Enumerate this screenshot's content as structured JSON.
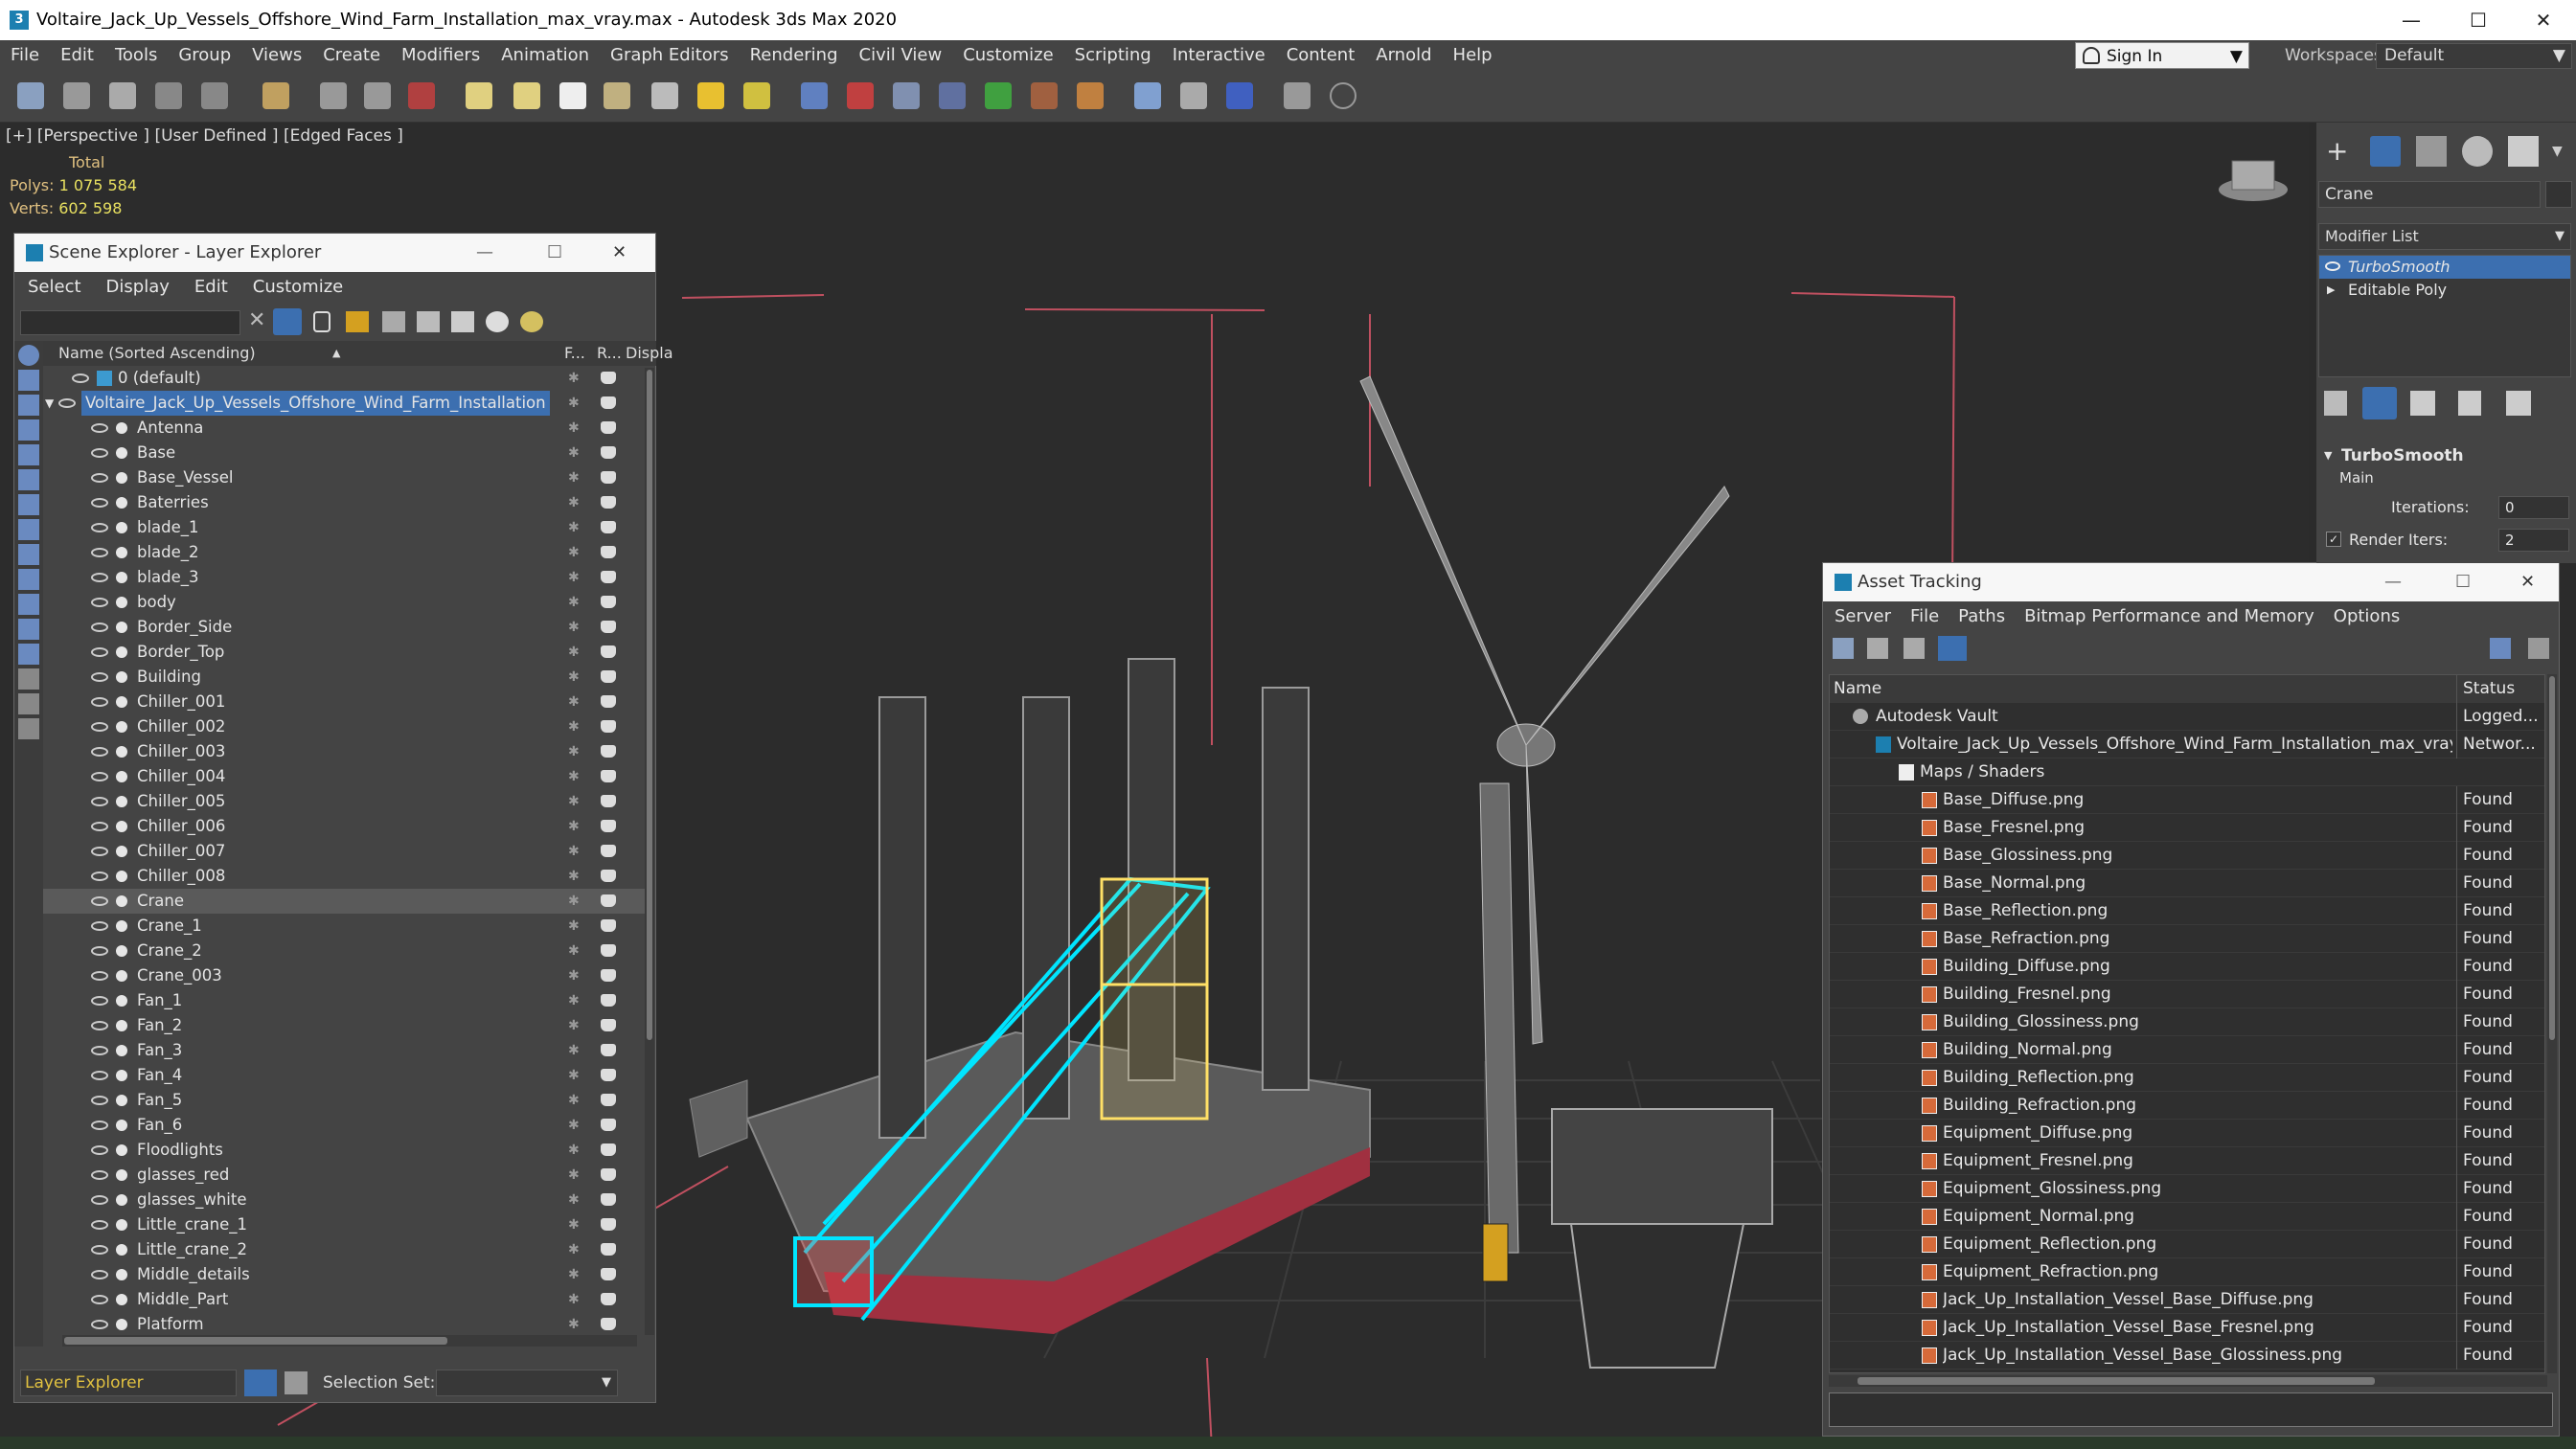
{
  "window": {
    "title": "Voltaire_Jack_Up_Vessels_Offshore_Wind_Farm_Installation_max_vray.max - Autodesk 3ds Max 2020"
  },
  "menu": [
    "File",
    "Edit",
    "Tools",
    "Group",
    "Views",
    "Create",
    "Modifiers",
    "Animation",
    "Graph Editors",
    "Rendering",
    "Civil View",
    "Customize",
    "Scripting",
    "Interactive",
    "Content",
    "Arnold",
    "Help"
  ],
  "signin": {
    "label": "Sign In"
  },
  "workspace": {
    "label": "Workspaces:",
    "value": "Default"
  },
  "viewport": {
    "label": "[+] [Perspective ] [User Defined ] [Edged Faces ]",
    "stats_title": "Total",
    "polys_label": "Polys:",
    "polys": "1 075 584",
    "verts_label": "Verts:",
    "verts": "602 598"
  },
  "scene_explorer": {
    "title": "Scene Explorer - Layer Explorer",
    "menu": [
      "Select",
      "Display",
      "Edit",
      "Customize"
    ],
    "columns": {
      "name": "Name (Sorted Ascending)",
      "frozen": "F...",
      "render": "R...",
      "display": "Displa"
    },
    "default_layer": "0 (default)",
    "root_layer": "Voltaire_Jack_Up_Vessels_Offshore_Wind_Farm_Installation",
    "items": [
      "Antenna",
      "Base",
      "Base_Vessel",
      "Baterries",
      "blade_1",
      "blade_2",
      "blade_3",
      "body",
      "Border_Side",
      "Border_Top",
      "Building",
      "Chiller_001",
      "Chiller_002",
      "Chiller_003",
      "Chiller_004",
      "Chiller_005",
      "Chiller_006",
      "Chiller_007",
      "Chiller_008",
      "Crane",
      "Crane_1",
      "Crane_2",
      "Crane_003",
      "Fan_1",
      "Fan_2",
      "Fan_3",
      "Fan_4",
      "Fan_5",
      "Fan_6",
      "Floodlights",
      "glasses_red",
      "glasses_white",
      "Little_crane_1",
      "Little_crane_2",
      "Middle_details",
      "Middle_Part",
      "Platform"
    ],
    "selected_item": "Crane",
    "explorer_select": "Layer Explorer",
    "selection_set_label": "Selection Set:"
  },
  "asset_tracking": {
    "title": "Asset Tracking",
    "menu": [
      "Server",
      "File",
      "Paths",
      "Bitmap Performance and Memory",
      "Options"
    ],
    "columns": {
      "name": "Name",
      "status": "Status"
    },
    "vault": {
      "name": "Autodesk Vault",
      "status": "Logged..."
    },
    "file": {
      "name": "Voltaire_Jack_Up_Vessels_Offshore_Wind_Farm_Installation_max_vray.max",
      "status": "Networ..."
    },
    "group": "Maps / Shaders",
    "maps": [
      {
        "name": "Base_Diffuse.png",
        "status": "Found"
      },
      {
        "name": "Base_Fresnel.png",
        "status": "Found"
      },
      {
        "name": "Base_Glossiness.png",
        "status": "Found"
      },
      {
        "name": "Base_Normal.png",
        "status": "Found"
      },
      {
        "name": "Base_Reflection.png",
        "status": "Found"
      },
      {
        "name": "Base_Refraction.png",
        "status": "Found"
      },
      {
        "name": "Building_Diffuse.png",
        "status": "Found"
      },
      {
        "name": "Building_Fresnel.png",
        "status": "Found"
      },
      {
        "name": "Building_Glossiness.png",
        "status": "Found"
      },
      {
        "name": "Building_Normal.png",
        "status": "Found"
      },
      {
        "name": "Building_Reflection.png",
        "status": "Found"
      },
      {
        "name": "Building_Refraction.png",
        "status": "Found"
      },
      {
        "name": "Equipment_Diffuse.png",
        "status": "Found"
      },
      {
        "name": "Equipment_Fresnel.png",
        "status": "Found"
      },
      {
        "name": "Equipment_Glossiness.png",
        "status": "Found"
      },
      {
        "name": "Equipment_Normal.png",
        "status": "Found"
      },
      {
        "name": "Equipment_Reflection.png",
        "status": "Found"
      },
      {
        "name": "Equipment_Refraction.png",
        "status": "Found"
      },
      {
        "name": "Jack_Up_Installation_Vessel_Base_Diffuse.png",
        "status": "Found"
      },
      {
        "name": "Jack_Up_Installation_Vessel_Base_Fresnel.png",
        "status": "Found"
      },
      {
        "name": "Jack_Up_Installation_Vessel_Base_Glossiness.png",
        "status": "Found"
      }
    ]
  },
  "command_panel": {
    "object_name": "Crane",
    "modifier_list": "Modifier List",
    "stack": [
      "TurboSmooth",
      "Editable Poly"
    ],
    "rollout_title": "TurboSmooth",
    "section": "Main",
    "iterations_label": "Iterations:",
    "iterations": "0",
    "render_iters_label": "Render Iters:",
    "render_iters": "2"
  },
  "colors": {
    "selection_blue": "#3c6fb0",
    "crane_wire": "#00e5ff",
    "crane_yellow": "#ffe066",
    "hull_red": "#a03040",
    "status_text": "#e8e8e8"
  }
}
